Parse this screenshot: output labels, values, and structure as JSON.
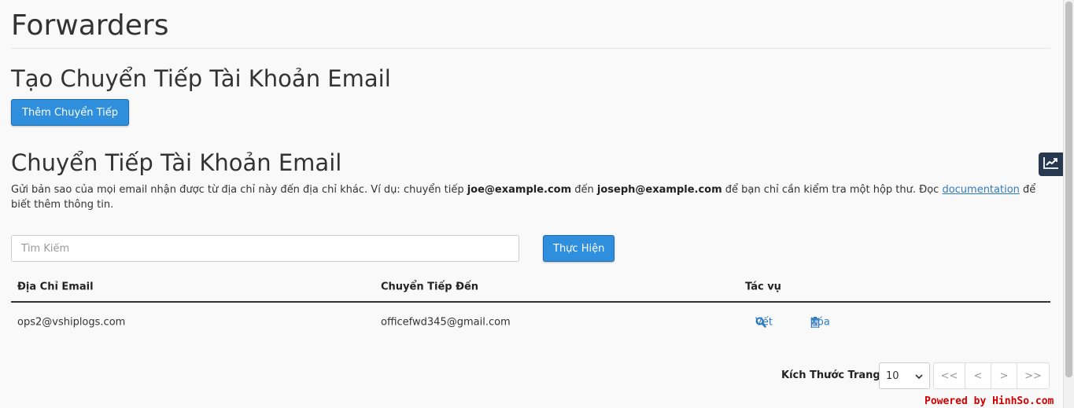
{
  "page_title": "Forwarders",
  "create_section": {
    "heading": "Tạo Chuyển Tiếp Tài Khoản Email",
    "add_button": "Thêm Chuyển Tiếp"
  },
  "list_section": {
    "heading": "Chuyển Tiếp Tài Khoản Email",
    "desc_part1": "Gửi bản sao của mọi email nhận được từ địa chỉ này đến địa chỉ khác. Ví dụ: chuyển tiếp ",
    "desc_bold1": "joe@example.com",
    "desc_part2": " đến ",
    "desc_bold2": "joseph@example.com",
    "desc_part3": " để bạn chỉ cần kiểm tra một hộp thư. Đọc ",
    "desc_link": "documentation",
    "desc_part4": " để biết thêm thông tin."
  },
  "search": {
    "placeholder": "Tìm Kiếm",
    "go_button": "Thực Hiện"
  },
  "table": {
    "headers": [
      "Địa Chỉ Email",
      "Chuyển Tiếp Đến",
      "Tác vụ"
    ],
    "rows": [
      {
        "email": "ops2@vshiplogs.com",
        "forward_to": "officefwd345@gmail.com",
        "action_track": "Vết",
        "action_delete": "Xóa"
      }
    ]
  },
  "pagination": {
    "page_size_label": "Kích Thước Trang",
    "page_size_value": "10",
    "buttons": [
      "<<",
      "<",
      ">",
      ">>"
    ]
  },
  "watermark": "Powered by HinhSo.com",
  "colors": {
    "primary": "#2f8fdc",
    "link": "#2f7bbf",
    "side_widget": "#28394f",
    "watermark": "#d00000"
  }
}
